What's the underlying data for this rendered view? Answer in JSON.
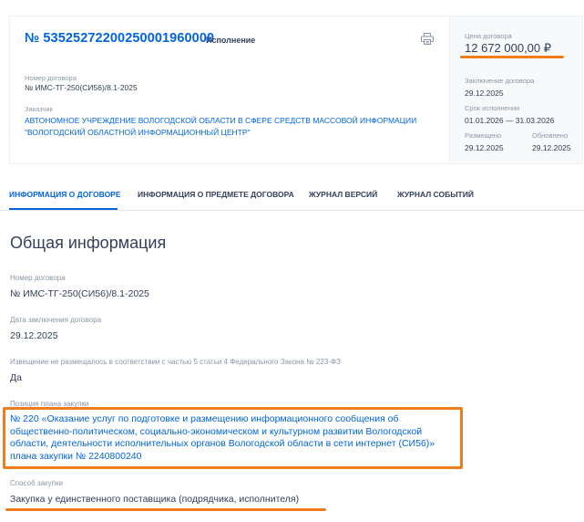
{
  "header": {
    "reg_number": "№ 53525272200250001960000",
    "status": "Исполнение"
  },
  "card": {
    "contract_number_label": "Номер договора",
    "contract_number": "№ ИМС-ТГ-250(СИ56)/8.1-2025",
    "customer_label": "Заказчик",
    "customer": "АВТОНОМНОЕ УЧРЕЖДЕНИЕ ВОЛОГОДСКОЙ ОБЛАСТИ В СФЕРЕ СРЕДСТВ МАССОВОЙ ИНФОРМАЦИИ \"ВОЛОГОДСКИЙ ОБЛАСТНОЙ ИНФОРМАЦИОННЫЙ ЦЕНТР\""
  },
  "summary": {
    "price_label": "Цена договора",
    "price": "12 672 000,00 ₽",
    "conclusion_label": "Заключение договора",
    "conclusion_date": "29.12.2025",
    "term_label": "Срок исполнения",
    "term": "01.01.2026 — 31.03.2026",
    "placed_label": "Размещено",
    "placed_date": "29.12.2025",
    "updated_label": "Обновлено",
    "updated_date": "29.12.2025"
  },
  "tabs": [
    {
      "label": "Информация о договоре",
      "active": true
    },
    {
      "label": "Информация о предмете договора",
      "active": false
    },
    {
      "label": "Журнал версий",
      "active": false
    },
    {
      "label": "Журнал событий",
      "active": false
    }
  ],
  "general": {
    "title": "Общая информация",
    "contract_number_label": "Номер договора",
    "contract_number": "№ ИМС-ТГ-250(СИ56)/8.1-2025",
    "conclusion_label": "Дата заключения договора",
    "conclusion_date": "29.12.2025",
    "notice_label": "Извещение не размещалось в соответствии с частью 5 статьи 4 Федерального Закона № 223-ФЗ",
    "notice_value": "Да",
    "plan_label": "Позиция плана закупки",
    "plan_position": "№ 220 «Оказание услуг по подготовке и размещению информационного сообщения об общественно-политическом, социально-экономическом и культурном развитии Вологодской области, деятельности исполнительных органов Вологодской области в сети интернет (СИ56)» плана закупки № 2240800240",
    "method_label": "Способ закупки",
    "method_value": "Закупка у единственного поставщика (подрядчика, исполнителя)"
  },
  "colors": {
    "accent": "#0065dd",
    "text": "#334059",
    "muted": "#8a96a8",
    "highlight": "#f07c1c"
  },
  "icons": {
    "print": "printer-icon"
  }
}
